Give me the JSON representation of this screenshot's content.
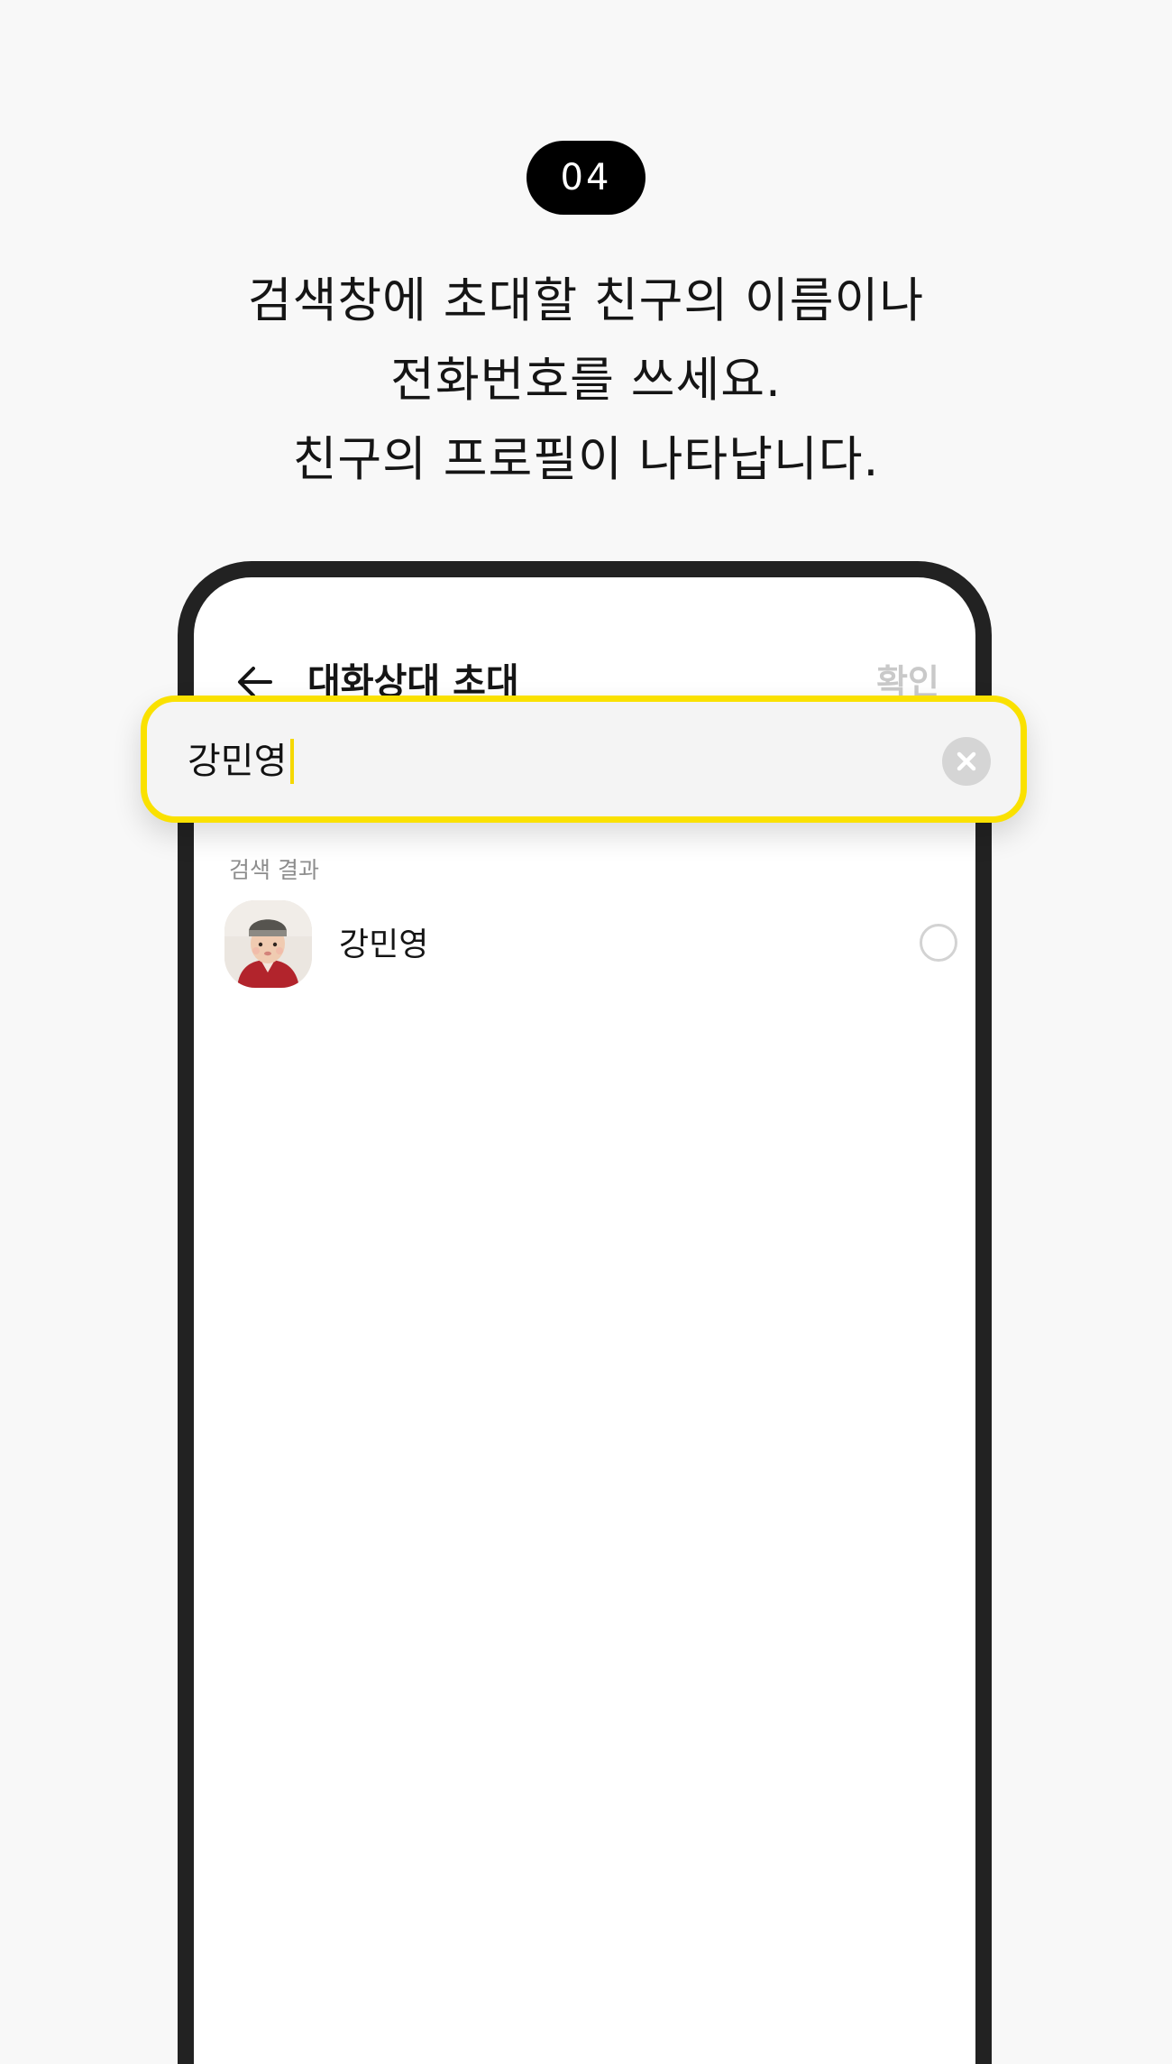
{
  "step_badge": "04",
  "instructions": {
    "line1": "검색창에 초대할 친구의 이름이나",
    "line2": "전화번호를 쓰세요.",
    "line3": "친구의 프로필이 나타납니다."
  },
  "app": {
    "title": "대화상대 초대",
    "confirm_label": "확인",
    "search": {
      "value": "강민영",
      "placeholder": ""
    },
    "results": {
      "section_label": "검색 결과",
      "items": [
        {
          "name": "강민영",
          "selected": false
        }
      ]
    }
  },
  "colors": {
    "page_background": "#f8f8f8",
    "badge_background": "#000000",
    "highlight_border": "#fae100",
    "phone_frame": "#222222",
    "confirm_disabled": "#c9c9c9",
    "section_label": "#8d8d8d",
    "clear_button": "#d5d5d5"
  },
  "icons": {
    "back": "arrow-left-icon",
    "clear": "close-circle-icon",
    "select": "radio-unchecked-icon"
  }
}
